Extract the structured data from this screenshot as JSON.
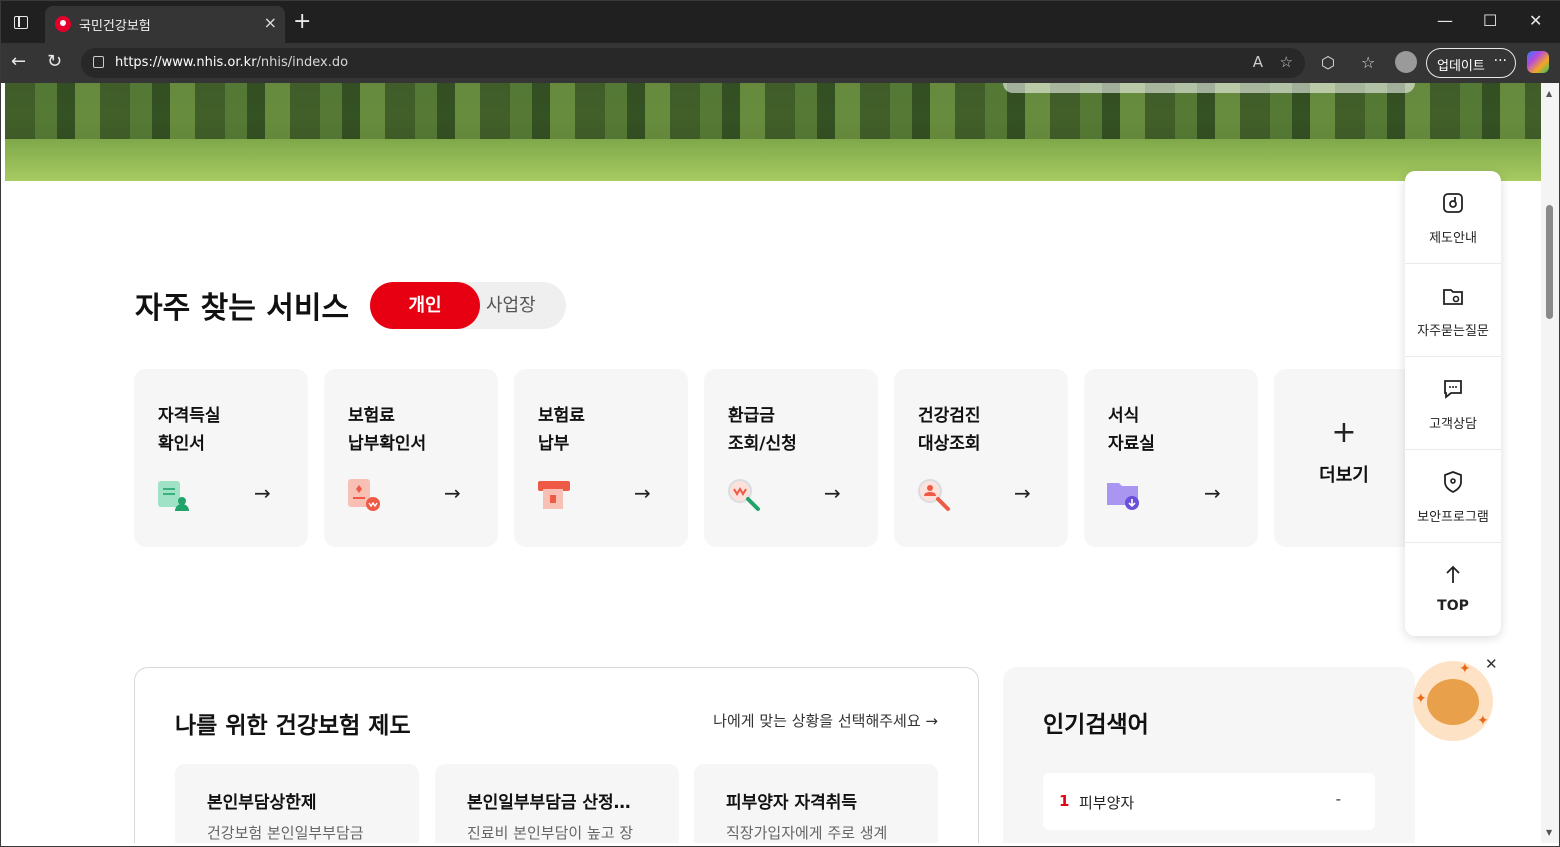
{
  "browser": {
    "tab_title": "국민건강보험",
    "tab_close": "×",
    "new_tab": "+",
    "url_host": "https://www.nhis.or.kr",
    "url_path": "/nhis/index.do",
    "update_label": "업데이트",
    "more_label": "···",
    "win_min": "—",
    "win_max": "☐",
    "win_close": "✕",
    "back": "←",
    "reload": "↻",
    "icons": [
      "read-aloud-icon",
      "favorite-star-icon",
      "extensions-icon",
      "favorites-icon",
      "profile-icon",
      "copilot-icon"
    ]
  },
  "services": {
    "title": "자주 찾는 서비스",
    "toggle": {
      "active": "개인",
      "inactive": "사업장"
    },
    "cards": [
      {
        "line1": "자격득실",
        "line2": "확인서",
        "icon": "certificate-icon",
        "arrow": "→"
      },
      {
        "line1": "보험료",
        "line2": "납부확인서",
        "icon": "payment-receipt-icon",
        "arrow": "→"
      },
      {
        "line1": "보험료",
        "line2": "납부",
        "icon": "payment-icon",
        "arrow": "→"
      },
      {
        "line1": "환급금",
        "line2": "조회/신청",
        "icon": "refund-search-icon",
        "arrow": "→"
      },
      {
        "line1": "건강검진",
        "line2": "대상조회",
        "icon": "checkup-search-icon",
        "arrow": "→"
      },
      {
        "line1": "서식",
        "line2": "자료실",
        "icon": "folder-download-icon",
        "arrow": "→"
      }
    ],
    "more": {
      "plus": "+",
      "label": "더보기"
    }
  },
  "insurance": {
    "title": "나를 위한 건강보험 제도",
    "link": "나에게 맞는 상황을 선택해주세요 →",
    "cards": [
      {
        "title": "본인부담상한제",
        "desc": "건강보험 본인일부부담금"
      },
      {
        "title": "본인일부부담금 산정…",
        "desc": "진료비 본인부담이 높고 장"
      },
      {
        "title": "피부양자 자격취득",
        "desc": "직장가입자에게 주로 생계"
      }
    ]
  },
  "popular": {
    "title": "인기검색어",
    "items": [
      {
        "rank": "1",
        "keyword": "피부양자",
        "change": "-"
      }
    ]
  },
  "quick_menu": [
    {
      "label": "제도안내",
      "icon": "guide-icon"
    },
    {
      "label": "자주묻는질문",
      "icon": "faq-folder-icon"
    },
    {
      "label": "고객상담",
      "icon": "chat-icon"
    },
    {
      "label": "보안프로그램",
      "icon": "shield-icon"
    },
    {
      "label": "TOP",
      "icon": "arrow-up-icon"
    }
  ],
  "mascot": {
    "close": "✕"
  },
  "colors": {
    "brand_red": "#e60012",
    "card_bg": "#f6f6f6",
    "browser_dark": "#202020"
  }
}
